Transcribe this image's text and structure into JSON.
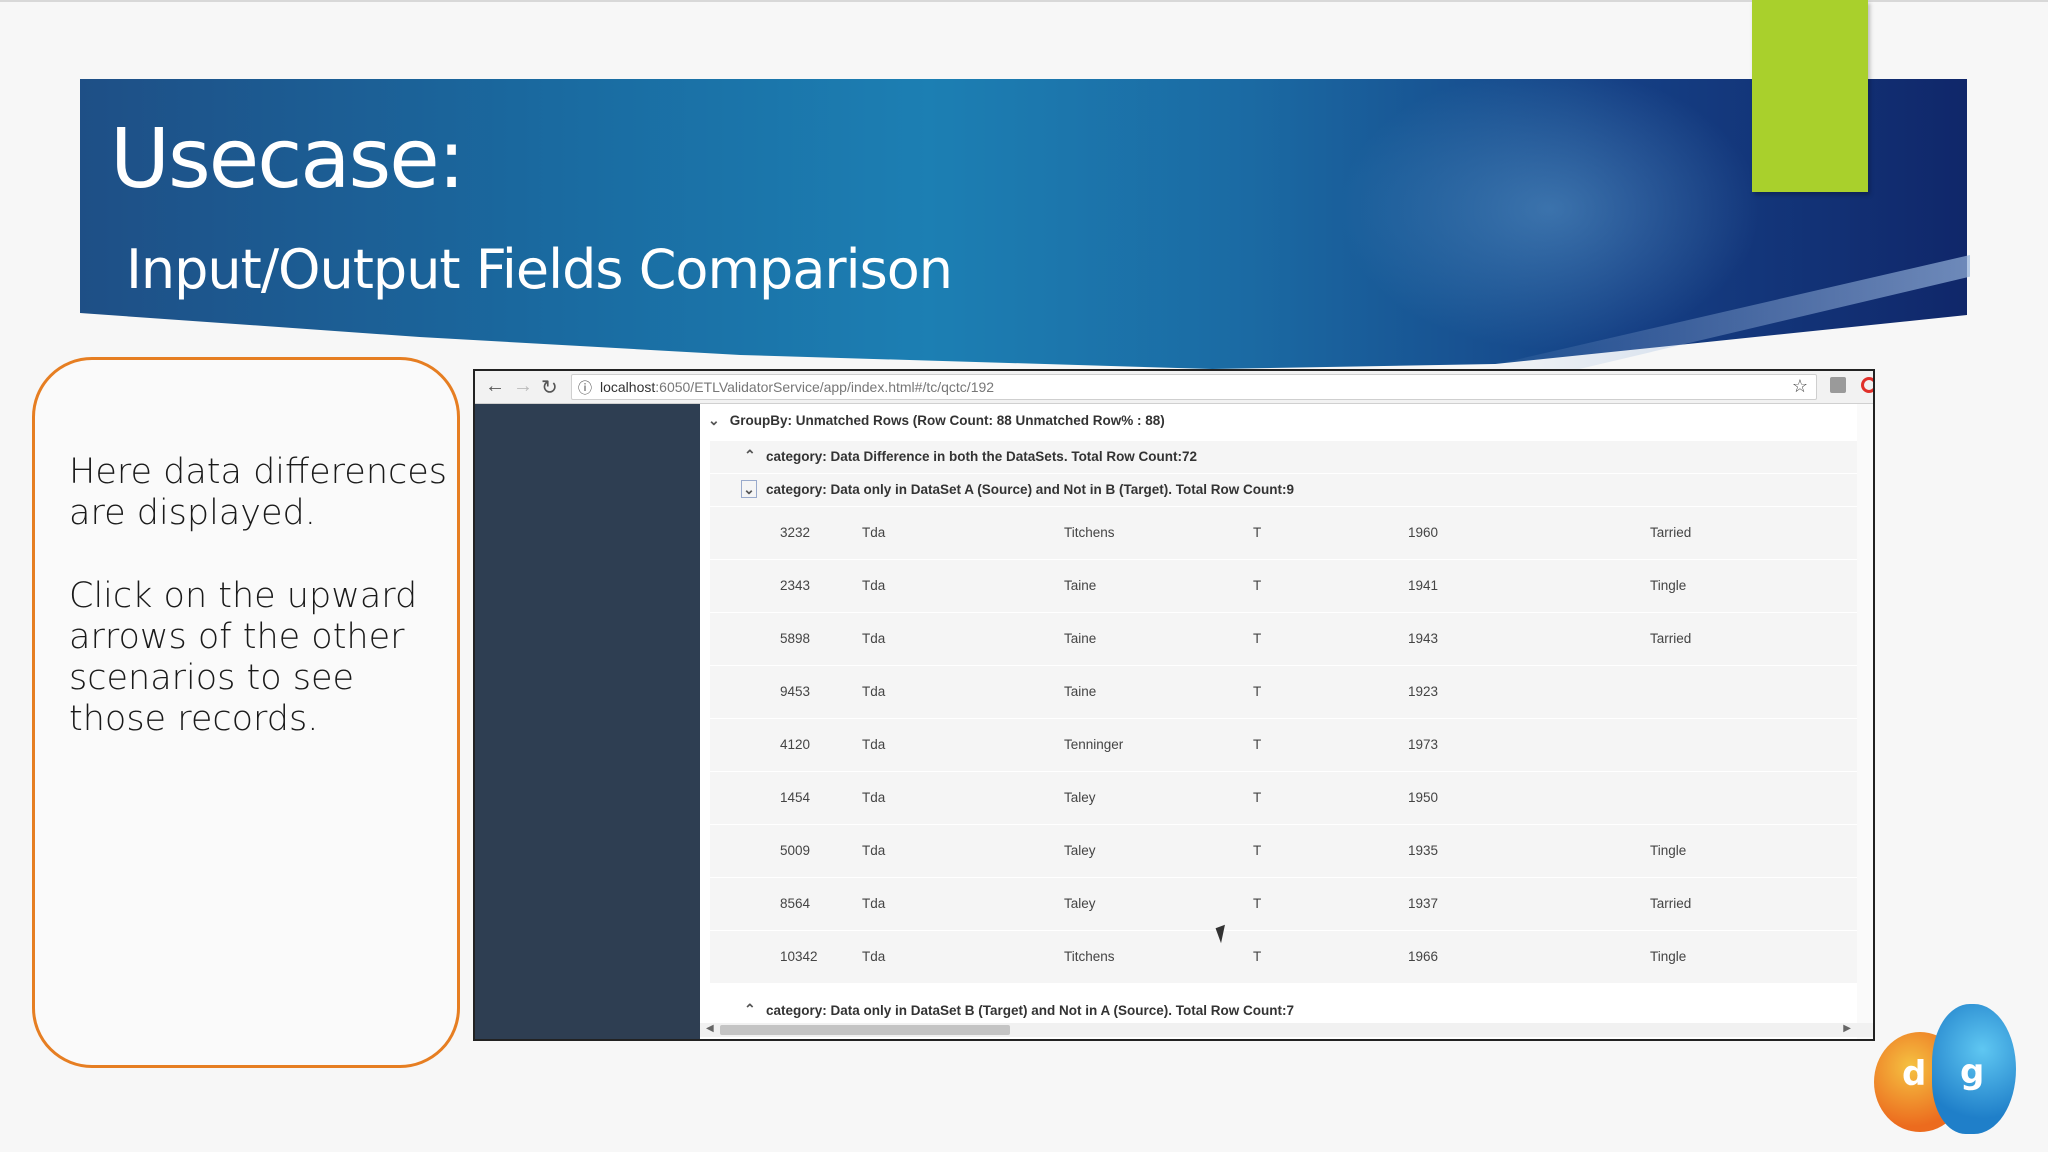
{
  "slide": {
    "title": "Usecase:",
    "subtitle": "Input/Output Fields Comparison",
    "accent_color": "#a9d02c",
    "note_border_color": "#e67e22"
  },
  "note": {
    "para1": "Here data differences are displayed.",
    "para2": "Click on the upward arrows of the other scenarios to see those records."
  },
  "browser": {
    "url_host": "localhost",
    "url_rest": ":6050/ETLValidatorService/app/index.html#/tc/qctc/192",
    "icons": [
      "back-arrow-icon",
      "forward-arrow-icon",
      "reload-icon",
      "info-icon",
      "star-icon"
    ]
  },
  "results": {
    "group_label": "GroupBy: Unmatched Rows (Row Count: 88 Unmatched Row% : 88)",
    "categories": [
      {
        "label": "category: Data Difference in both the DataSets. Total Row Count:72",
        "expanded": false
      },
      {
        "label": "category: Data only in DataSet A (Source) and Not in B (Target). Total Row Count:9",
        "expanded": true
      },
      {
        "label": "category: Data only in DataSet B (Target) and Not in A (Source). Total Row Count:7",
        "expanded": false
      }
    ],
    "rows": [
      [
        "3232",
        "Tda",
        "Titchens",
        "T",
        "1960",
        "Tarried"
      ],
      [
        "2343",
        "Tda",
        "Taine",
        "T",
        "1941",
        "Tingle"
      ],
      [
        "5898",
        "Tda",
        "Taine",
        "T",
        "1943",
        "Tarried"
      ],
      [
        "9453",
        "Tda",
        "Taine",
        "T",
        "1923",
        ""
      ],
      [
        "4120",
        "Tda",
        "Tenninger",
        "T",
        "1973",
        ""
      ],
      [
        "1454",
        "Tda",
        "Taley",
        "T",
        "1950",
        ""
      ],
      [
        "5009",
        "Tda",
        "Taley",
        "T",
        "1935",
        "Tingle"
      ],
      [
        "8564",
        "Tda",
        "Taley",
        "T",
        "1937",
        "Tarried"
      ],
      [
        "10342",
        "Tda",
        "Titchens",
        "T",
        "1966",
        "Tingle"
      ]
    ]
  },
  "logo": {
    "left_letter": "d",
    "right_letter": "g"
  }
}
